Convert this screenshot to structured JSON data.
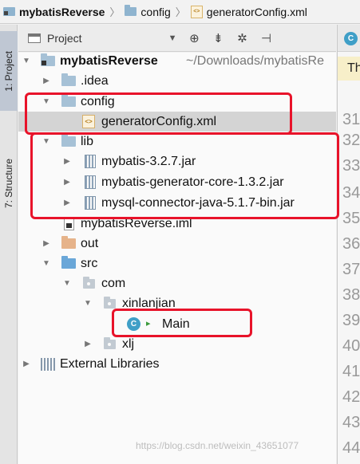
{
  "breadcrumb": {
    "project": "mybatisReverse",
    "folder": "config",
    "file": "generatorConfig.xml"
  },
  "tool_windows": {
    "project_tab": "1: Project",
    "structure_tab": "7: Structure"
  },
  "panel": {
    "title": "Project",
    "tools": [
      "target-icon",
      "collapse-icon",
      "gear-icon",
      "hide-icon"
    ]
  },
  "tree": {
    "root": {
      "name": "mybatisReverse",
      "path": "~/Downloads/mybatisRe"
    },
    "idea": ".idea",
    "config": ".config_placeholder",
    "config_label": "config",
    "config_file": "generatorConfig.xml",
    "lib": "lib",
    "jars": [
      "mybatis-3.2.7.jar",
      "mybatis-generator-core-1.3.2.jar",
      "mysql-connector-java-5.1.7-bin.jar"
    ],
    "iml": "mybatisReverse.iml",
    "out": "out",
    "src": "src",
    "com": "com",
    "xinlanjian": "xinlanjian",
    "main": "Main",
    "xlj": "xlj",
    "external": "External Libraries"
  },
  "editor": {
    "banner_text": "Th",
    "line_numbers": [
      "31",
      "32",
      "33",
      "34",
      "35",
      "36",
      "37",
      "38",
      "39",
      "40",
      "41",
      "42",
      "43",
      "44"
    ]
  },
  "watermark": "https://blog.csdn.net/weixin_43651077",
  "colors": {
    "highlight": "#e8132a",
    "selection": "#d4d4d4",
    "folder": "#a6c1d6",
    "excluded_folder": "#e6b38a",
    "source_folder": "#6aa7d8"
  }
}
